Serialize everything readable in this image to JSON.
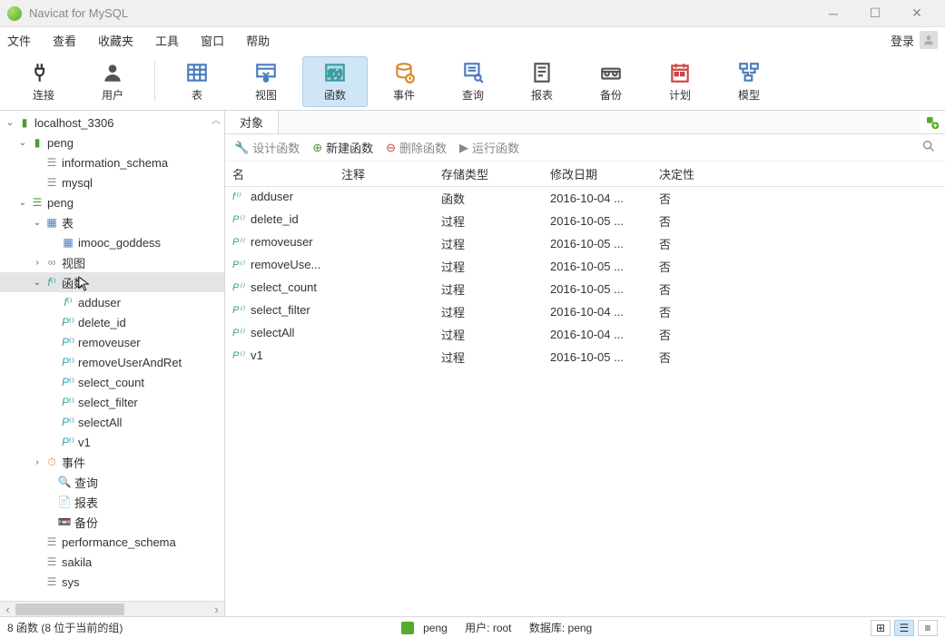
{
  "app": {
    "title": "Navicat for MySQL"
  },
  "menu": {
    "file": "文件",
    "view": "查看",
    "favorites": "收藏夹",
    "tools": "工具",
    "window": "窗口",
    "help": "帮助",
    "login": "登录"
  },
  "toolbar": {
    "connect": "连接",
    "user": "用户",
    "table": "表",
    "view": "视图",
    "function": "函数",
    "event": "事件",
    "query": "查询",
    "report": "报表",
    "backup": "备份",
    "plan": "计划",
    "model": "模型"
  },
  "tree": {
    "conn": "localhost_3306",
    "db_peng": "peng",
    "db_info": "information_schema",
    "db_mysql": "mysql",
    "db_perf": "performance_schema",
    "db_sakila": "sakila",
    "db_sys": "sys",
    "tables": "表",
    "tbl_imooc": "imooc_goddess",
    "views": "视图",
    "functions": "函数",
    "events": "事件",
    "queries": "查询",
    "reports": "报表",
    "backups": "备份",
    "fn": {
      "adduser": "adduser",
      "delete_id": "delete_id",
      "removeuser": "removeuser",
      "removeUserAndRet": "removeUserAndRet",
      "select_count": "select_count",
      "select_filter": "select_filter",
      "selectAll": "selectAll",
      "v1": "v1"
    }
  },
  "tab": {
    "objects": "对象"
  },
  "subtoolbar": {
    "design": "设计函数",
    "new": "新建函数",
    "delete": "删除函数",
    "run": "运行函数"
  },
  "grid": {
    "headers": {
      "name": "名",
      "comment": "注释",
      "storage": "存储类型",
      "modified": "修改日期",
      "determinism": "决定性"
    },
    "rows": [
      {
        "icon": "f",
        "name": "adduser",
        "storage": "函数",
        "modified": "2016-10-04 ...",
        "det": "否"
      },
      {
        "icon": "p",
        "name": "delete_id",
        "storage": "过程",
        "modified": "2016-10-05 ...",
        "det": "否"
      },
      {
        "icon": "p",
        "name": "removeuser",
        "storage": "过程",
        "modified": "2016-10-05 ...",
        "det": "否"
      },
      {
        "icon": "p",
        "name": "removeUse...",
        "storage": "过程",
        "modified": "2016-10-05 ...",
        "det": "否"
      },
      {
        "icon": "p",
        "name": "select_count",
        "storage": "过程",
        "modified": "2016-10-05 ...",
        "det": "否"
      },
      {
        "icon": "p",
        "name": "select_filter",
        "storage": "过程",
        "modified": "2016-10-04 ...",
        "det": "否"
      },
      {
        "icon": "p",
        "name": "selectAll",
        "storage": "过程",
        "modified": "2016-10-04 ...",
        "det": "否"
      },
      {
        "icon": "p",
        "name": "v1",
        "storage": "过程",
        "modified": "2016-10-05 ...",
        "det": "否"
      }
    ]
  },
  "status": {
    "left": "8 函数 (8 位于当前的组)",
    "db": "peng",
    "user": "用户: root",
    "database": "数据库: peng"
  }
}
